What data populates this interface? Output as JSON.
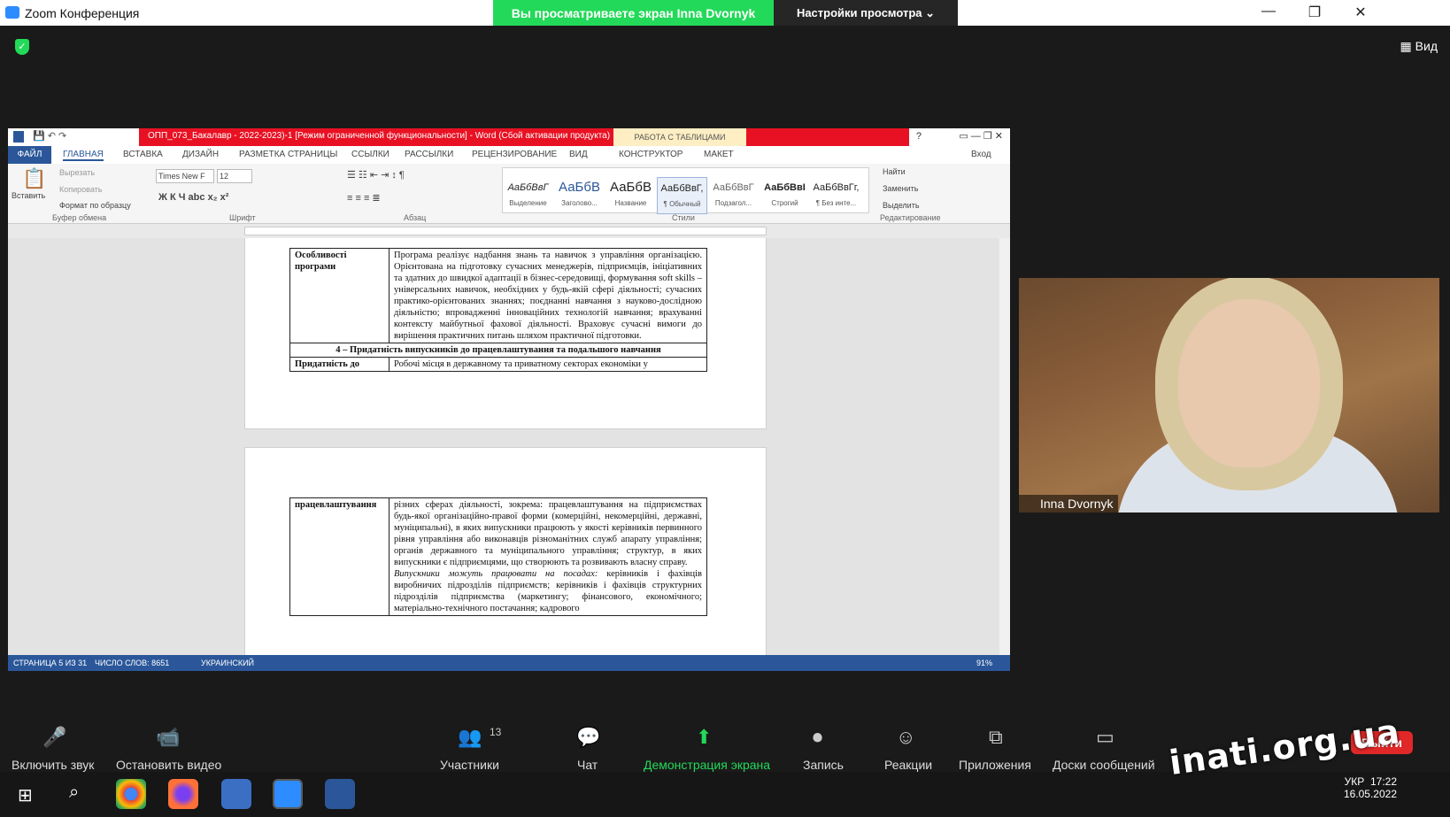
{
  "window": {
    "title": "Zoom Конференция",
    "share_banner": "Вы просматриваете экран Inna Dvornyk",
    "view_options": "Настройки просмотра",
    "view_btn": "Вид"
  },
  "word": {
    "doc_title": "ОПП_073_Бакалавр - 2022-2023)-1 [Режим ограниченной функциональности] - Word (Сбой активации продукта)",
    "table_tools": "РАБОТА С ТАБЛИЦАМИ",
    "signin": "Вход",
    "tabs": [
      "ФАЙЛ",
      "ГЛАВНАЯ",
      "ВСТАВКА",
      "ДИЗАЙН",
      "РАЗМЕТКА СТРАНИЦЫ",
      "ССЫЛКИ",
      "РАССЫЛКИ",
      "РЕЦЕНЗИРОВАНИЕ",
      "ВИД",
      "КОНСТРУКТОР",
      "МАКЕТ"
    ],
    "clipboard": {
      "paste": "Вставить",
      "cut": "Вырезать",
      "copy": "Копировать",
      "format": "Формат по образцу",
      "group": "Буфер обмена"
    },
    "font": {
      "name": "Times New F",
      "size": "12",
      "group": "Шрифт"
    },
    "para_group": "Абзац",
    "styles": [
      {
        "sample": "АаБбВвГ",
        "name": "Выделение"
      },
      {
        "sample": "АаБбВ",
        "name": "Заголово..."
      },
      {
        "sample": "АаБбВ",
        "name": "Название"
      },
      {
        "sample": "АаБбВвГ,",
        "name": "¶ Обычный"
      },
      {
        "sample": "АаБбВвГ",
        "name": "Подзагол..."
      },
      {
        "sample": "АаБбВвІ",
        "name": "Строгий"
      },
      {
        "sample": "АаБбВвГг,",
        "name": "¶ Без инте..."
      }
    ],
    "styles_group": "Стили",
    "edit": {
      "find": "Найти",
      "replace": "Заменить",
      "select": "Выделить",
      "group": "Редактирование"
    },
    "table1": {
      "r1c1": "Особливості програми",
      "r1c2": "Програма реалізує надбання знань та навичок з управління організацією. Орієнтована на підготовку сучасних менеджерів, підприємців, ініціативних та здатних до швидкої адаптації в бізнес-середовищі, формування soft skills – універсальних навичок, необхідних у будь-якій сфері діяльності; сучасних практико-орієнтованих знаннях; поєднанні навчання з науково-дослідною діяльністю; впровадженні інноваційних технологій навчання; врахуванні контексту майбутньої фахової діяльності. Враховує сучасні вимоги до вирішення практичних питань шляхом практичної підготовки.",
      "section": "4 – Придатність випускників до працевлаштування та подальшого навчання",
      "r3c1": "Придатність до",
      "r3c2": "Робочі місця в державному та приватному секторах економіки у"
    },
    "table2": {
      "c1": "працевлаштування",
      "p1": "різних сферах діяльності, зокрема: працевлаштування на підприємствах будь-якої організаційно-правої форми (комерційні, некомерційні, державні, муніципальні), в яких випускники працюють у якості керівників первинного рівня управління або виконавців різноманітних служб апарату управління; органів державного та муніципального управління; структур, в яких випускники є підприємцями, що створюють та розвивають власну справу.",
      "p2i": "Випускники можуть працювати на посадах:",
      "p2": " керівників і фахівців виробничих підрозділів підприємств; керівників і фахівців структурних підрозділів підприємства (маркетингу; фінансового, економічного; матеріально-технічного постачання; кадрового"
    },
    "status": {
      "page": "СТРАНИЦА 5 ИЗ 31",
      "words": "ЧИСЛО СЛОВ: 8651",
      "lang": "УКРАИНСКИЙ",
      "zoom": "91%"
    }
  },
  "video": {
    "name": "Inna Dvornyk"
  },
  "toolbar": {
    "audio": "Включить звук",
    "video": "Остановить видео",
    "participants": "Участники",
    "participants_count": "13",
    "chat": "Чат",
    "share": "Демонстрация экрана",
    "record": "Запись",
    "reactions": "Реакции",
    "apps": "Приложения",
    "whiteboard": "Доски сообщений",
    "leave": "Выйти"
  },
  "taskbar": {
    "lang": "УКР",
    "time": "17:22",
    "date": "16.05.2022"
  },
  "watermark": "inati.org.ua"
}
